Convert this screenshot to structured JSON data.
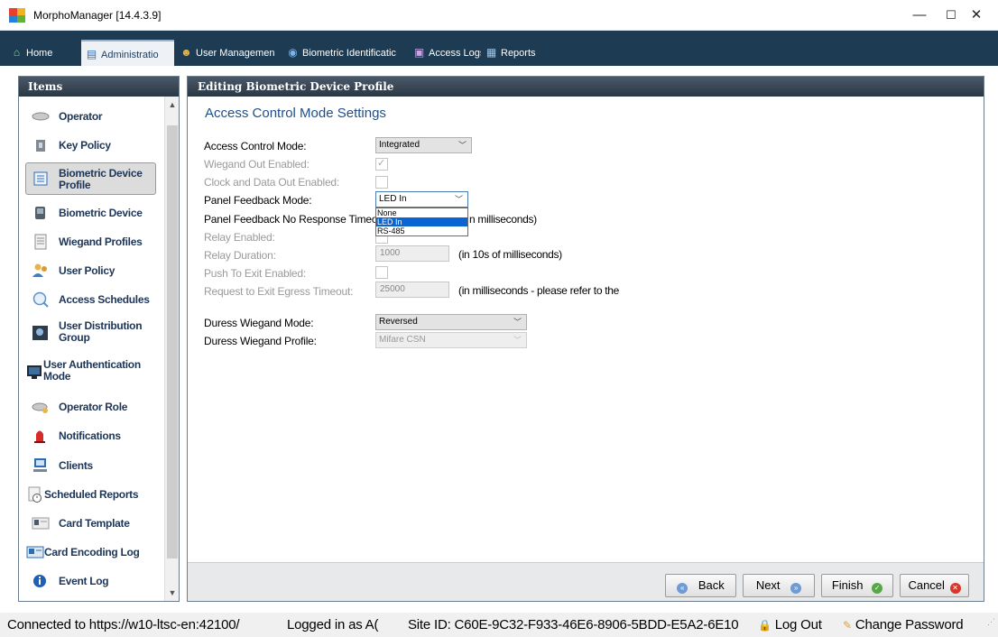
{
  "window": {
    "title": "MorphoManager [14.4.3.9]",
    "minimize": "—",
    "maximize": "☐",
    "close": "✕"
  },
  "nav": {
    "tabs": [
      {
        "label": "Home",
        "icon": "home-icon"
      },
      {
        "label": "Administratio",
        "icon": "administration-icon"
      },
      {
        "label": "User Managemen",
        "icon": "users-icon"
      },
      {
        "label": "Biometric Identificatic",
        "icon": "biometric-icon"
      },
      {
        "label": "Access Logs",
        "icon": "access-logs-icon"
      },
      {
        "label": "Reports",
        "icon": "reports-icon"
      }
    ],
    "active_index": 1
  },
  "sidebar": {
    "header": "Items",
    "items": [
      {
        "label": "Operator"
      },
      {
        "label": "Key Policy"
      },
      {
        "label": "Biometric Device Profile",
        "label1": "Biometric Device",
        "label2": "Profile"
      },
      {
        "label": "Biometric Device"
      },
      {
        "label": "Wiegand Profiles"
      },
      {
        "label": "User Policy"
      },
      {
        "label": "Access Schedules"
      },
      {
        "label": "User Distribution Group",
        "label1": "User Distribution",
        "label2": "Group"
      },
      {
        "label": "User Authentication Mode",
        "label1": "User Authentication",
        "label2": "Mode"
      },
      {
        "label": "Operator Role"
      },
      {
        "label": "Notifications"
      },
      {
        "label": "Clients"
      },
      {
        "label": "Scheduled Reports"
      },
      {
        "label": "Card Template"
      },
      {
        "label": "Card Encoding Log"
      },
      {
        "label": "Event Log"
      }
    ],
    "selected_index": 2
  },
  "main": {
    "header": "Editing Biometric Device Profile",
    "section_title": "Access Control Mode Settings",
    "fields": {
      "access_control_mode": {
        "label": "Access Control Mode:",
        "value": "Integrated"
      },
      "wiegand_out_enabled": {
        "label": "Wiegand Out Enabled:",
        "checked": true
      },
      "clock_data_out_enabled": {
        "label": "Clock and Data Out Enabled:",
        "checked": false
      },
      "panel_feedback_mode": {
        "label": "Panel Feedback Mode:",
        "value": "LED In",
        "options": [
          "None",
          "LED In",
          "RS-485"
        ]
      },
      "panel_feedback_timeout": {
        "label": "Panel Feedback No Response Timeou",
        "hint": "n milliseconds)"
      },
      "relay_enabled": {
        "label": "Relay Enabled:"
      },
      "relay_duration": {
        "label": "Relay Duration:",
        "value": "1000",
        "hint": "(in 10s of milliseconds)"
      },
      "push_to_exit": {
        "label": "Push To Exit Enabled:",
        "checked": false
      },
      "request_exit_timeout": {
        "label": "Request to Exit Egress Timeout:",
        "value": "25000",
        "hint": "(in milliseconds - please refer to the"
      },
      "duress_wiegand_mode": {
        "label": "Duress Wiegand Mode:",
        "value": "Reversed"
      },
      "duress_wiegand_profile": {
        "label": "Duress Wiegand Profile:",
        "value": "Mifare CSN"
      }
    },
    "buttons": {
      "back": "Back",
      "next": "Next",
      "finish": "Finish",
      "cancel": "Cancel"
    }
  },
  "statusbar": {
    "connection": "Connected to https://w10-ltsc-en:42100/",
    "logged_in": "Logged in as A(",
    "site_id": "Site ID: C60E-9C32-F933-46E6-8906-5BDD-E5A2-6E10",
    "logout": "Log Out",
    "change_password": "Change Password"
  },
  "colors": {
    "navbar": "#1d3b52",
    "section_title": "#1e4f8a",
    "selection": "#0a64d2"
  }
}
